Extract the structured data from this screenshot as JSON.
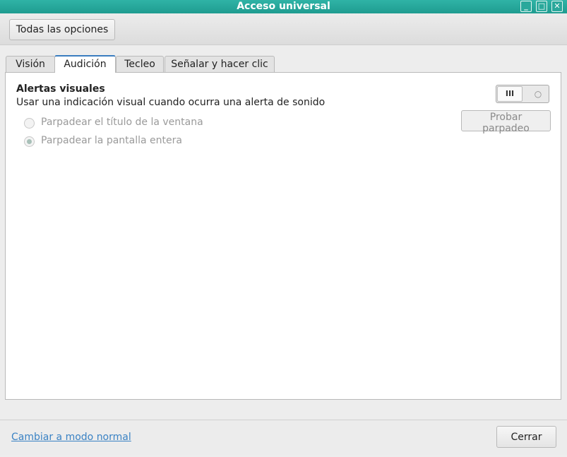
{
  "window": {
    "title": "Acceso universal",
    "controls": {
      "minimize": "_",
      "maximize": "□",
      "close": "✕"
    }
  },
  "toolbar": {
    "all_settings_label": "Todas las opciones"
  },
  "tabs": [
    {
      "label": "Visión",
      "active": false
    },
    {
      "label": "Audición",
      "active": true
    },
    {
      "label": "Tecleo",
      "active": false
    },
    {
      "label": "Señalar y hacer clic",
      "active": false
    }
  ],
  "visual_alerts": {
    "heading": "Alertas visuales",
    "description": "Usar una indicación visual cuando ocurra una alerta de sonido",
    "toggle": {
      "on_glyph": "III",
      "off_glyph": "○",
      "state": "on"
    },
    "test_button_label": "Probar parpadeo",
    "options": [
      {
        "label": "Parpadear el título de la ventana",
        "checked": false,
        "disabled": true
      },
      {
        "label": "Parpadear la pantalla entera",
        "checked": true,
        "disabled": true
      }
    ]
  },
  "footer": {
    "switch_mode_link": "Cambiar a modo normal",
    "close_label": "Cerrar"
  },
  "colors": {
    "titlebar": "#26a69a",
    "tab_active_border": "#3a7dbf",
    "link": "#3a82c4"
  }
}
